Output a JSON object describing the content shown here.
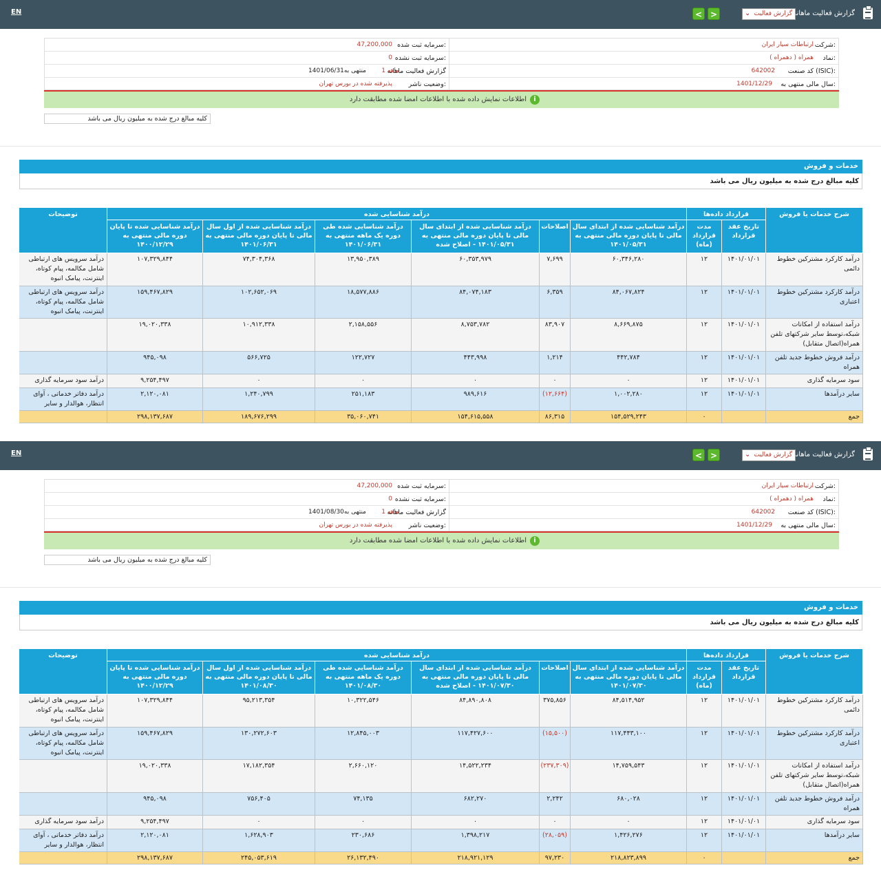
{
  "common": {
    "lang_link": "EN",
    "report_title": "گزارش فعالیت ماهانه",
    "report_select": "گزارش فعالیت",
    "nav_prev": "<",
    "nav_next": ">",
    "label_company": "شرکت:",
    "label_symbol": "نماد:",
    "label_isic": "کد صنعت (ISIC):",
    "label_fy": "سال مالی منتهی به:",
    "label_cap_reg": "سرمایه ثبت شده:",
    "label_cap_unreg": "سرمایه ثبت نشده:",
    "label_report": "گزارش فعالیت ماهانه",
    "label_status": "وضعیت ناشر:",
    "company": "ارتباطات سیار ایران",
    "symbol": "همراه ( دهمراه )",
    "isic": "642002",
    "fy_end": "1401/12/29",
    "cap_registered": "47,200,000",
    "cap_unregistered": "0",
    "status": "پذیرفته شده در بورس تهران",
    "green_message": "اطلاعات نمایش داده شده با اطلاعات امضا شده مطابقت دارد",
    "info_icon": "i",
    "amount_note": "کلیه مبالغ درج شده به میلیون ریال می باشد",
    "section_title": "خدمات و فروش",
    "unit_note": "کلیه مبالغ درج شده به میلیون ریال می باشد",
    "h_desc": "شرح خدمات یا فروش",
    "h_contract": "قرارداد داده‌ها",
    "h_contract_date": "تاریخ عقد قرارداد",
    "h_duration": "مدت قرارداد (ماه)",
    "h_recognized": "درآمد شناسایی شده",
    "h_adjust": "اصلاحات",
    "h_notes": "توضیحات",
    "row_labels": [
      "درآمد کارکرد مشترکین خطوط دائمی",
      "درآمد کارکرد مشترکین خطوط اعتباری",
      "درآمد استفاده از امکانات شبکه،توسط سایر شرکتهای تلفن همراه(اتصال متقابل)",
      "درآمد فروش خطوط جدید تلفن همراه",
      "سود سرمایه گذاری",
      "سایر درآمدها",
      "جمع"
    ],
    "row_notes": [
      "درآمد سرویس های ارتباطی شامل مکالمه، پیام کوتاه، اینترنت، پیامک انبوه",
      "درآمد سرویس های ارتباطی شامل مکالمه، پیام کوتاه، اینترنت، پیامک انبوه",
      "",
      "",
      "درآمد سود سرمایه گذاری",
      "درآمد دفاتر خدماتی ، آوای انتظار، هوالدار و سایر",
      ""
    ],
    "contract_dates": [
      "۱۴۰۱/۰۱/۰۱",
      "۱۴۰۱/۰۱/۰۱",
      "۱۴۰۱/۰۱/۰۱",
      "۱۴۰۱/۰۱/۰۱",
      "۱۴۰۱/۰۱/۰۱",
      "۱۴۰۱/۰۱/۰۱",
      ""
    ],
    "durations": [
      "۱۲",
      "۱۲",
      "۱۲",
      "۱۲",
      "۱۲",
      "۱۲",
      "۰"
    ]
  },
  "panels": [
    {
      "report_period": "منتهی به1401/06/31",
      "report_months": "1 ماهه",
      "h_col1": "درآمد شناسایی شده از ابتدای سال مالی تا پایان دوره مالی منتهی به ۱۴۰۱/۰۵/۳۱",
      "h_col3": "درآمد شناسایی شده از ابتدای سال مالی تا پایان دوره مالی منتهی به ۱۴۰۱/۰۵/۳۱ - اصلاح شده",
      "h_col4": "درآمد شناسایی شده طی دوره یک ماهه منتهی به ۱۴۰۱/۰۶/۳۱",
      "h_col5": "درآمد شناسایی شده از اول سال مالی تا پایان دوره مالی منتهی به ۱۴۰۱/۰۶/۳۱",
      "h_col6": "درآمد شناسایی شده تا پایان دوره مالی منتهی به ۱۴۰۰/۱۲/۲۹",
      "rows": [
        [
          "۶۰,۳۴۶,۲۸۰",
          "۷,۶۹۹",
          "۶۰,۳۵۳,۹۷۹",
          "۱۳,۹۵۰,۳۸۹",
          "۷۴,۳۰۴,۳۶۸",
          "۱۰۷,۳۲۹,۸۴۴"
        ],
        [
          "۸۴,۰۶۷,۸۲۴",
          "۶,۳۵۹",
          "۸۴,۰۷۴,۱۸۳",
          "۱۸,۵۷۷,۸۸۶",
          "۱۰۲,۶۵۲,۰۶۹",
          "۱۵۹,۴۶۷,۸۲۹"
        ],
        [
          "۸,۶۶۹,۸۷۵",
          "۸۳,۹۰۷",
          "۸,۷۵۳,۷۸۲",
          "۲,۱۵۸,۵۵۶",
          "۱۰,۹۱۲,۳۳۸",
          "۱۹,۰۲۰,۳۳۸"
        ],
        [
          "۴۴۲,۷۸۴",
          "۱,۲۱۴",
          "۴۴۳,۹۹۸",
          "۱۲۲,۷۲۷",
          "۵۶۶,۷۲۵",
          "۹۴۵,۰۹۸"
        ],
        [
          "۰",
          "۰",
          "۰",
          "۰",
          "۰",
          "۹,۲۵۴,۴۹۷"
        ],
        [
          "۱,۰۰۲,۲۸۰",
          "(۱۲,۶۶۴)",
          "۹۸۹,۶۱۶",
          "۲۵۱,۱۸۳",
          "۱,۲۴۰,۷۹۹",
          "۲,۱۲۰,۰۸۱"
        ],
        [
          "۱۵۴,۵۲۹,۲۴۳",
          "۸۶,۳۱۵",
          "۱۵۴,۶۱۵,۵۵۸",
          "۳۵,۰۶۰,۷۴۱",
          "۱۸۹,۶۷۶,۲۹۹",
          "۲۹۸,۱۳۷,۶۸۷"
        ]
      ],
      "neg": [
        [],
        [],
        [],
        [],
        [],
        [
          1
        ],
        []
      ]
    },
    {
      "report_period": "منتهی به1401/08/30",
      "report_months": "1 ماهه",
      "h_col1": "درآمد شناسایی شده از ابتدای سال مالی تا پایان دوره مالی منتهی به ۱۴۰۱/۰۷/۳۰",
      "h_col3": "درآمد شناسایی شده از ابتدای سال مالی تا پایان دوره مالی منتهی به ۱۴۰۱/۰۷/۳۰ - اصلاح شده",
      "h_col4": "درآمد شناسایی شده طی دوره یک ماهه منتهی به ۱۴۰۱/۰۸/۳۰",
      "h_col5": "درآمد شناسایی شده از اول سال مالی تا پایان دوره مالی منتهی به ۱۴۰۱/۰۸/۳۰",
      "h_col6": "درآمد شناسایی شده تا پایان دوره مالی منتهی به ۱۴۰۰/۱۲/۲۹",
      "rows": [
        [
          "۸۴,۵۱۴,۹۵۲",
          "۳۷۵,۸۵۶",
          "۸۴,۸۹۰,۸۰۸",
          "۱۰,۳۲۲,۵۴۶",
          "۹۵,۲۱۳,۳۵۴",
          "۱۰۷,۳۲۹,۸۴۴"
        ],
        [
          "۱۱۷,۴۴۳,۱۰۰",
          "(۱۵,۵۰۰)",
          "۱۱۷,۴۲۷,۶۰۰",
          "۱۲,۸۴۵,۰۰۳",
          "۱۳۰,۲۷۲,۶۰۳",
          "۱۵۹,۴۶۷,۸۲۹"
        ],
        [
          "۱۴,۷۵۹,۵۴۳",
          "(۲۳۷,۳۰۹)",
          "۱۴,۵۲۲,۲۳۴",
          "۲,۶۶۰,۱۲۰",
          "۱۷,۱۸۲,۳۵۴",
          "۱۹,۰۲۰,۳۳۸"
        ],
        [
          "۶۸۰,۰۲۸",
          "۲,۲۴۲",
          "۶۸۲,۲۷۰",
          "۷۴,۱۳۵",
          "۷۵۶,۴۰۵",
          "۹۴۵,۰۹۸"
        ],
        [
          "۰",
          "۰",
          "۰",
          "۰",
          "۰",
          "۹,۲۵۴,۴۹۷"
        ],
        [
          "۱,۴۲۶,۲۷۶",
          "(۲۸,۰۵۹)",
          "۱,۳۹۸,۲۱۷",
          "۲۳۰,۶۸۶",
          "۱,۶۲۸,۹۰۳",
          "۲,۱۲۰,۰۸۱"
        ],
        [
          "۲۱۸,۸۲۳,۸۹۹",
          "۹۷,۲۳۰",
          "۲۱۸,۹۲۱,۱۲۹",
          "۲۶,۱۳۲,۴۹۰",
          "۲۴۵,۰۵۳,۶۱۹",
          "۲۹۸,۱۳۷,۶۸۷"
        ]
      ],
      "neg": [
        [],
        [
          1
        ],
        [
          1
        ],
        [],
        [],
        [
          1
        ],
        []
      ]
    }
  ]
}
